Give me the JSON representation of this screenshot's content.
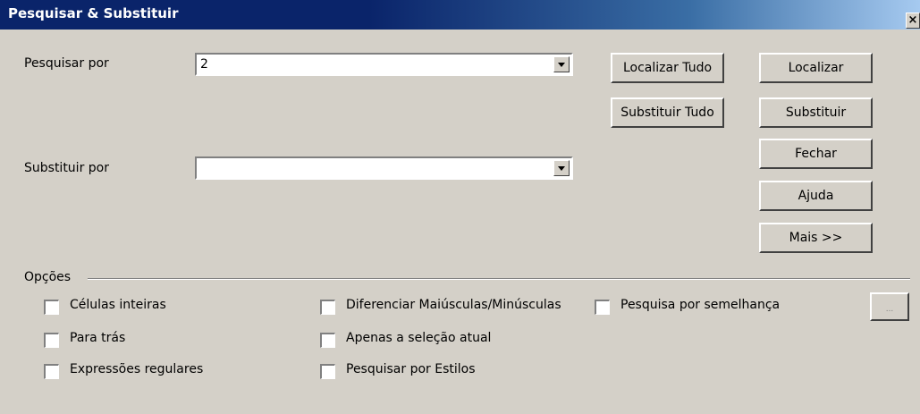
{
  "title": "Pesquisar & Substituir",
  "search": {
    "label": "Pesquisar por",
    "value": "2"
  },
  "replace": {
    "label": "Substituir por",
    "value": ""
  },
  "buttons": {
    "find_all": "Localizar Tudo",
    "find": "Localizar",
    "replace_all": "Substituir Tudo",
    "replace": "Substituir",
    "close": "Fechar",
    "help": "Ajuda",
    "more": "Mais >>",
    "attributes": "..."
  },
  "options": {
    "label": "Opções",
    "items": [
      {
        "label": "Células inteiras",
        "checked": false
      },
      {
        "label": "Para trás",
        "checked": false
      },
      {
        "label": "Expressões regulares",
        "checked": false
      },
      {
        "label": "Diferenciar Maiúsculas/Minúsculas",
        "checked": false
      },
      {
        "label": "Apenas a seleção atual",
        "checked": false
      },
      {
        "label": "Pesquisar por Estilos",
        "checked": false
      },
      {
        "label": "Pesquisa por semelhança",
        "checked": false
      }
    ]
  }
}
